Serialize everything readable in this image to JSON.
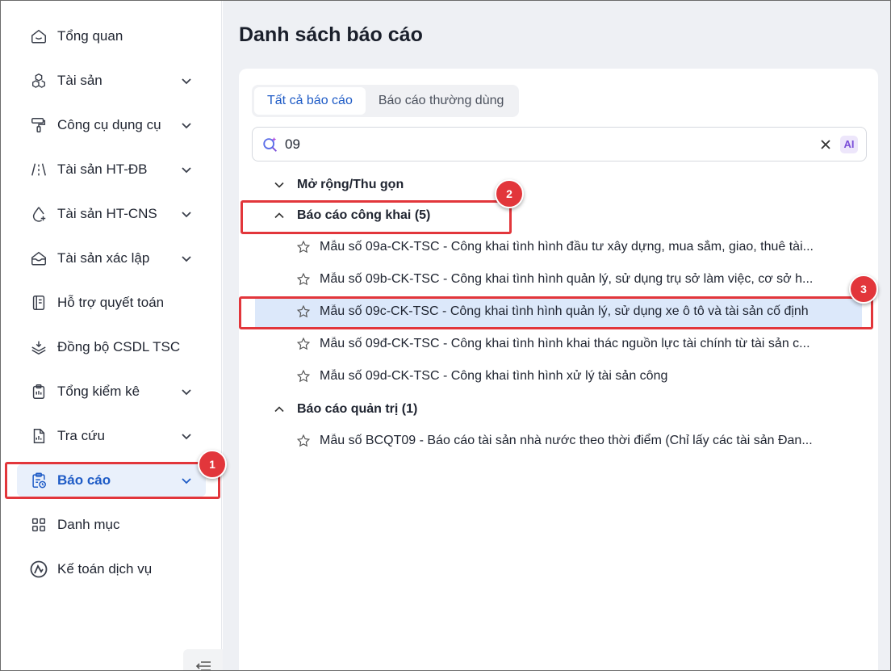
{
  "sidebar": {
    "items": [
      {
        "label": "Tổng quan",
        "icon": "home-icon",
        "has_chevron": false
      },
      {
        "label": "Tài sản",
        "icon": "cubes-icon",
        "has_chevron": true
      },
      {
        "label": "Công cụ dụng cụ",
        "icon": "paint-roller-icon",
        "has_chevron": true
      },
      {
        "label": "Tài sản HT-ĐB",
        "icon": "road-icon",
        "has_chevron": true
      },
      {
        "label": "Tài sản HT-CNS",
        "icon": "water-drop-icon",
        "has_chevron": true
      },
      {
        "label": "Tài sản xác lập",
        "icon": "inbox-icon",
        "has_chevron": true
      },
      {
        "label": "Hỗ trợ quyết toán",
        "icon": "ledger-icon",
        "has_chevron": false
      },
      {
        "label": "Đồng bộ CSDL TSC",
        "icon": "layers-sync-icon",
        "has_chevron": false
      },
      {
        "label": "Tổng kiểm kê",
        "icon": "clipboard-check-icon",
        "has_chevron": true
      },
      {
        "label": "Tra cứu",
        "icon": "document-chart-icon",
        "has_chevron": true
      },
      {
        "label": "Báo cáo",
        "icon": "clipboard-clock-icon",
        "has_chevron": true,
        "active": true
      },
      {
        "label": "Danh mục",
        "icon": "grid-icon",
        "has_chevron": false
      },
      {
        "label": "Kế toán dịch vụ",
        "icon": "accounting-logo-icon",
        "has_chevron": false
      }
    ]
  },
  "main": {
    "title": "Danh sách báo cáo",
    "tabs": [
      {
        "label": "Tất cả báo cáo",
        "active": true
      },
      {
        "label": "Báo cáo thường dùng",
        "active": false
      }
    ],
    "search": {
      "value": "09",
      "ai_label": "AI"
    },
    "expand_collapse_label": "Mở rộng/Thu gọn",
    "groups": [
      {
        "label": "Báo cáo công khai (5)",
        "items": [
          "Mẫu số 09a-CK-TSC - Công khai tình hình đầu tư xây dựng, mua sắm, giao, thuê tài...",
          "Mẫu số 09b-CK-TSC - Công khai tình hình quản lý, sử dụng trụ sở làm việc, cơ sở h...",
          "Mẫu số 09c-CK-TSC - Công khai tình hình quản lý, sử dụng xe ô tô và tài sản cố định",
          "Mẫu số 09đ-CK-TSC - Công khai tình hình khai thác nguồn lực tài chính từ tài sản c...",
          "Mẫu số 09d-CK-TSC - Công khai tình hình xử lý tài sản công"
        ]
      },
      {
        "label": "Báo cáo quản trị (1)",
        "items": [
          "Mẫu số BCQT09 - Báo cáo tài sản nhà nước theo thời điểm (Chỉ lấy các tài sản Đan..."
        ]
      }
    ]
  },
  "annotations": {
    "badge_1": "1",
    "badge_2": "2",
    "badge_3": "3",
    "color": "#e2363b"
  },
  "colors": {
    "accent": "#1e5bc6",
    "selected_row": "#dce8fa",
    "background": "#eef0f4"
  }
}
